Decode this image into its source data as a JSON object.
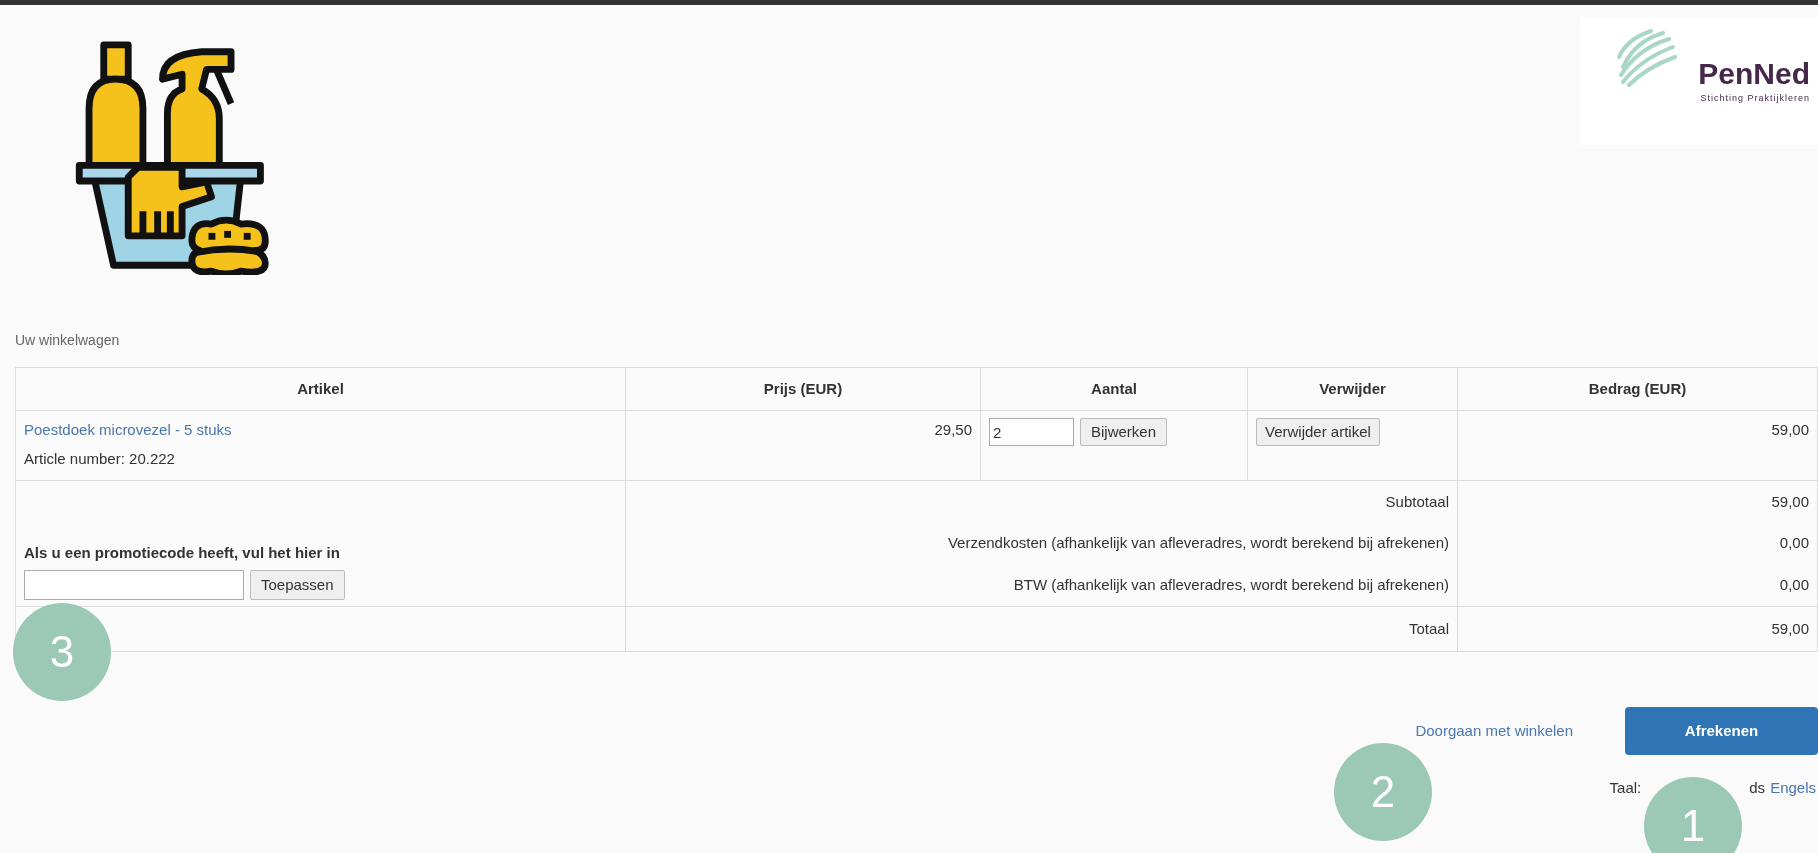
{
  "logo": {
    "name": "PenNed",
    "tagline": "Stichting Praktijkleren"
  },
  "cart_title": "Uw winkelwagen",
  "table": {
    "columns": [
      "Artikel",
      "Prijs (EUR)",
      "Aantal",
      "Verwijder",
      "Bedrag (EUR)"
    ],
    "rows": [
      {
        "product": "Poestdoek microvezel - 5 stuks",
        "article_number": "Article number: 20.222",
        "price": "29,50",
        "quantity": "2",
        "update_button": "Bijwerken",
        "remove_button": "Verwijder artikel",
        "amount": "59,00"
      }
    ],
    "summary": [
      {
        "label": "Subtotaal",
        "value": "59,00"
      },
      {
        "label": "Verzendkosten (afhankelijk van afleveradres, wordt berekend bij afrekenen)",
        "value": "0,00"
      },
      {
        "label": "BTW (afhankelijk van afleveradres, wordt berekend bij afrekenen)",
        "value": "0,00"
      },
      {
        "label": "Totaal",
        "value": "59,00"
      }
    ]
  },
  "promo": {
    "label": "Als u een promotiecode heeft, vul het hier in",
    "button": "Toepassen"
  },
  "actions": {
    "continue_link": "Doorgaan met winkelen",
    "checkout_button": "Afrekenen"
  },
  "language": {
    "label": "Taal:",
    "current_partial": "ds",
    "other_link": "Engels"
  },
  "markers": [
    "3",
    "2",
    "1"
  ]
}
